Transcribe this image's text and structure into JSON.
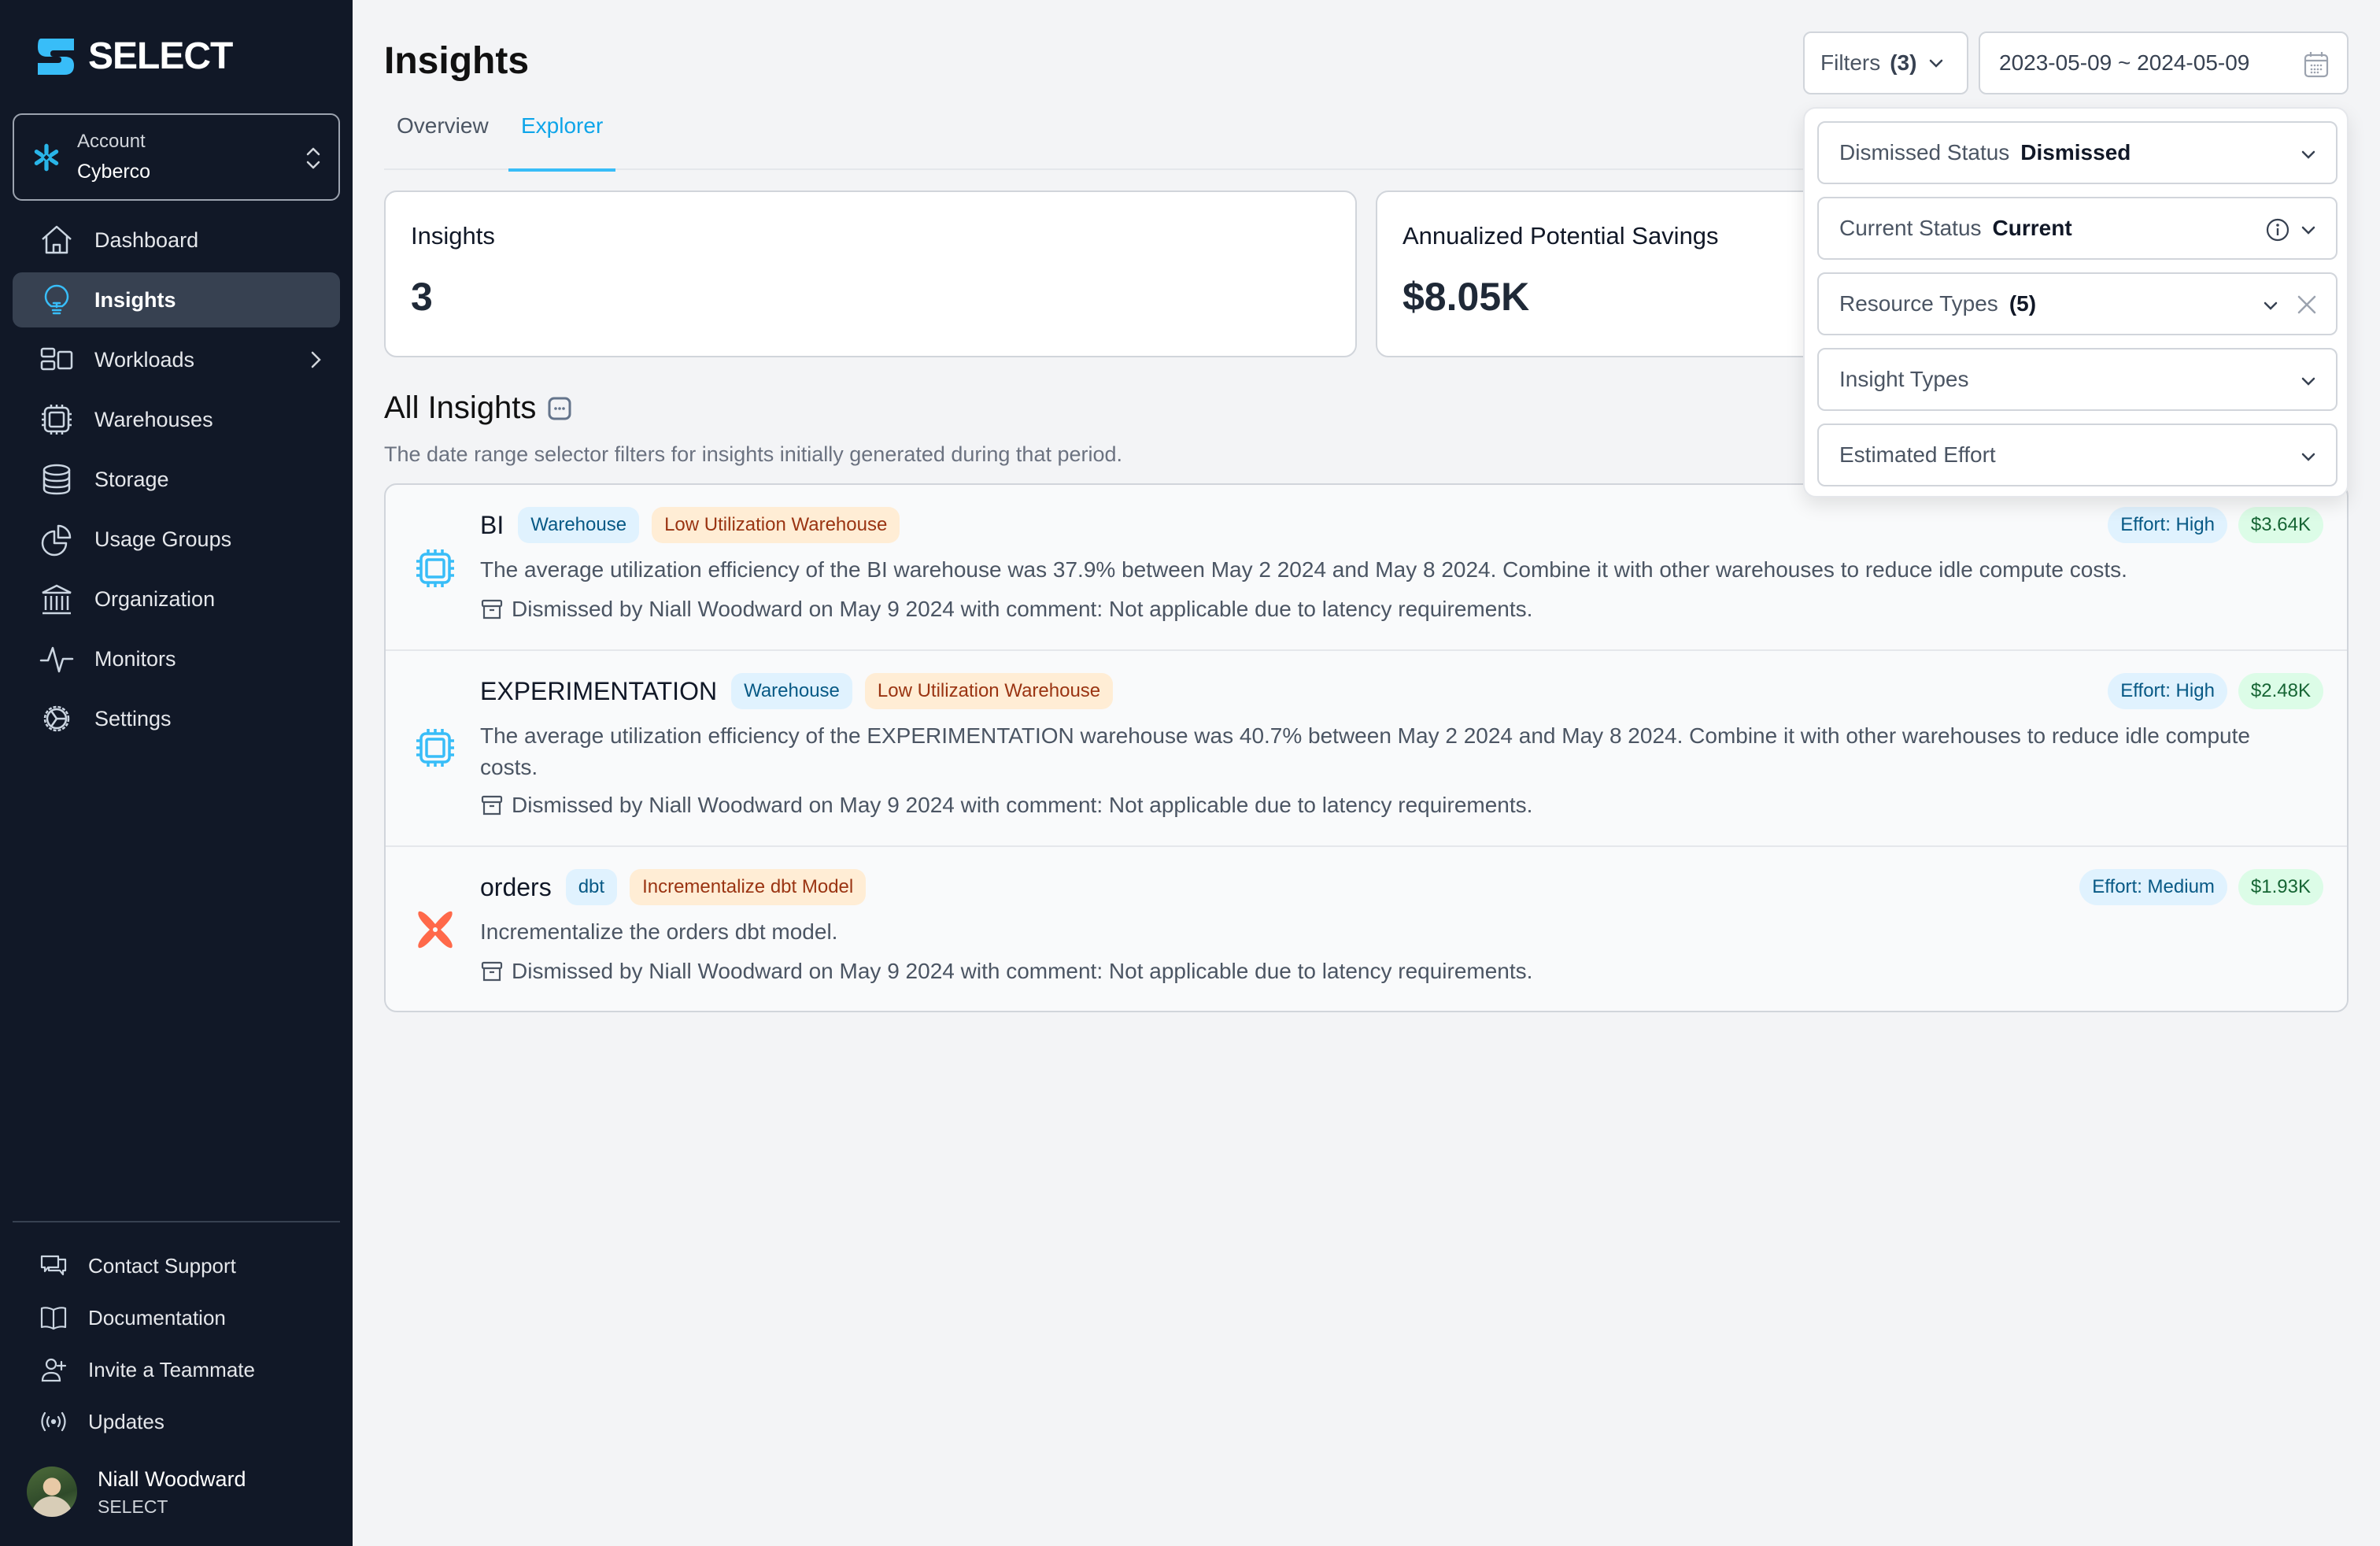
{
  "app": {
    "brand": "SELECT",
    "brand_color": "#38bdf8",
    "sidebar_bg": "#111827"
  },
  "account": {
    "label": "Account",
    "name": "Cyberco",
    "icon": "snowflake-icon"
  },
  "sidebar": {
    "items": [
      {
        "label": "Dashboard",
        "icon": "home-icon",
        "active": false
      },
      {
        "label": "Insights",
        "icon": "lightbulb-icon",
        "active": true
      },
      {
        "label": "Workloads",
        "icon": "workloads-icon",
        "active": false,
        "has_submenu": true
      },
      {
        "label": "Warehouses",
        "icon": "chip-icon",
        "active": false
      },
      {
        "label": "Storage",
        "icon": "database-icon",
        "active": false
      },
      {
        "label": "Usage Groups",
        "icon": "pie-chart-icon",
        "active": false
      },
      {
        "label": "Organization",
        "icon": "bank-icon",
        "active": false
      },
      {
        "label": "Monitors",
        "icon": "pulse-icon",
        "active": false
      },
      {
        "label": "Settings",
        "icon": "gear-icon",
        "active": false
      }
    ],
    "footer": [
      {
        "label": "Contact Support",
        "icon": "chat-icon"
      },
      {
        "label": "Documentation",
        "icon": "book-icon"
      },
      {
        "label": "Invite a Teammate",
        "icon": "user-plus-icon"
      },
      {
        "label": "Updates",
        "icon": "broadcast-icon"
      }
    ],
    "user": {
      "name": "Niall Woodward",
      "org": "SELECT"
    }
  },
  "header": {
    "title": "Insights",
    "tabs": [
      {
        "label": "Overview",
        "active": false
      },
      {
        "label": "Explorer",
        "active": true
      }
    ],
    "filters_label": "Filters",
    "filters_count": "(3)",
    "date_range": "2023-05-09 ~ 2024-05-09"
  },
  "filter_panel": {
    "fields": [
      {
        "label": "Dismissed Status",
        "value": "Dismissed"
      },
      {
        "label": "Current Status",
        "value": "Current",
        "has_info": true
      },
      {
        "label": "Resource Types",
        "value": "(5)",
        "clearable": true
      },
      {
        "label": "Insight Types",
        "value": ""
      },
      {
        "label": "Estimated Effort",
        "value": ""
      }
    ]
  },
  "stats": [
    {
      "label": "Insights",
      "value": "3"
    },
    {
      "label": "Annualized Potential Savings",
      "value": "$8.05K"
    }
  ],
  "insights_section": {
    "title": "All Insights",
    "subtitle": "The date range selector filters for insights initially generated during that period."
  },
  "insights": [
    {
      "name": "BI",
      "resource_type": "Warehouse",
      "insight_type": "Low Utilization Warehouse",
      "icon": "chip-icon",
      "effort": "Effort: High",
      "savings": "$3.64K",
      "description": "The average utilization efficiency of the BI warehouse was 37.9% between May 2 2024 and May 8 2024. Combine it with other warehouses to reduce idle compute costs.",
      "dismissal": "Dismissed by Niall Woodward on May 9 2024 with comment: Not applicable due to latency requirements."
    },
    {
      "name": "EXPERIMENTATION",
      "resource_type": "Warehouse",
      "insight_type": "Low Utilization Warehouse",
      "icon": "chip-icon",
      "effort": "Effort: High",
      "savings": "$2.48K",
      "description": "The average utilization efficiency of the EXPERIMENTATION warehouse was 40.7% between May 2 2024 and May 8 2024. Combine it with other warehouses to reduce idle compute costs.",
      "dismissal": "Dismissed by Niall Woodward on May 9 2024 with comment: Not applicable due to latency requirements."
    },
    {
      "name": "orders",
      "resource_type": "dbt",
      "insight_type": "Incrementalize dbt Model",
      "icon": "dbt-icon",
      "effort": "Effort: Medium",
      "savings": "$1.93K",
      "description": "Incrementalize the orders dbt model.",
      "dismissal": "Dismissed by Niall Woodward on May 9 2024 with comment: Not applicable due to latency requirements."
    }
  ]
}
